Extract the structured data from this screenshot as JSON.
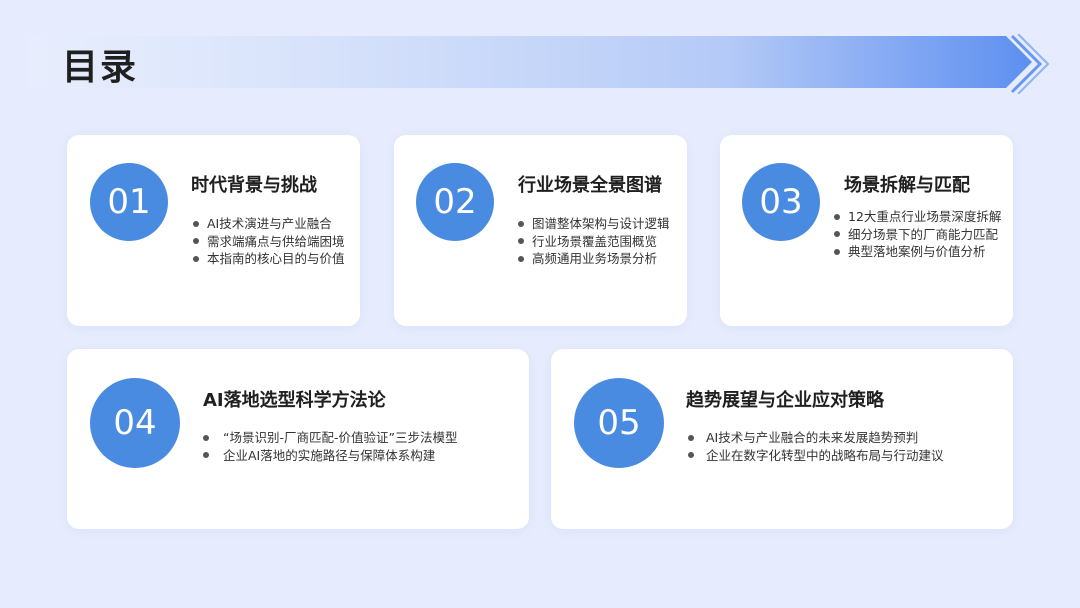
{
  "page": {
    "title": "目录"
  },
  "sections": [
    {
      "number": "01",
      "title": "时代背景与挑战",
      "bullets": [
        "AI技术演进与产业融合",
        "需求端痛点与供给端困境",
        "本指南的核心目的与价值"
      ]
    },
    {
      "number": "02",
      "title": "行业场景全景图谱",
      "bullets": [
        "图谱整体架构与设计逻辑",
        "行业场景覆盖范围概览",
        "高频通用业务场景分析"
      ]
    },
    {
      "number": "03",
      "title": "场景拆解与匹配",
      "bullets": [
        "12大重点行业场景深度拆解",
        "细分场景下的厂商能力匹配",
        "典型落地案例与价值分析"
      ]
    },
    {
      "number": "04",
      "title": "AI落地选型科学方法论",
      "bullets": [
        "“场景识别-厂商匹配-价值验证”三步法模型",
        "企业AI落地的实施路径与保障体系构建"
      ]
    },
    {
      "number": "05",
      "title": "趋势展望与企业应对策略",
      "bullets": [
        "AI技术与产业融合的未来发展趋势预判",
        "企业在数字化转型中的战略布局与行动建议"
      ]
    }
  ],
  "colors": {
    "accent": "#4a8be2",
    "background": "#e6ecfd",
    "card": "#ffffff"
  }
}
